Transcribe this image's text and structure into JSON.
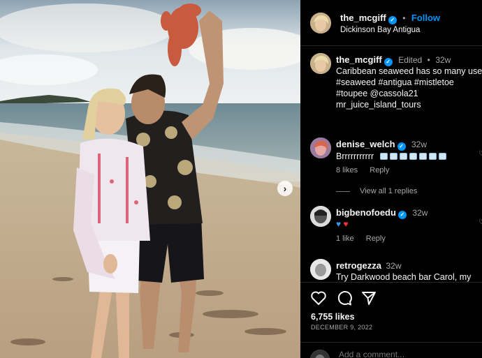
{
  "post": {
    "header": {
      "username": "the_mcgiff",
      "follow_label": "Follow",
      "location": "Dickinson Bay Antigua",
      "separator": "•"
    },
    "caption": {
      "username": "the_mcgiff",
      "edited": "Edited",
      "separator": "•",
      "time": "32w",
      "lines": [
        "Caribbean seaweed has so many uses",
        "#seaweed #antigua #mistletoe",
        "#toupee @cassola21",
        "mr_juice_island_tours"
      ]
    },
    "comments": [
      {
        "username": "denise_welch",
        "time": "32w",
        "text": "Brrrrrrrrrrr",
        "emoji": [
          "cube-emoji",
          "cube-emoji",
          "cube-emoji",
          "cube-emoji",
          "cube-emoji",
          "cube-emoji",
          "cube-emoji"
        ],
        "likes": "8 likes",
        "reply_label": "Reply",
        "view_replies": "View all 1 replies"
      },
      {
        "username": "bigbenofoedu",
        "time": "32w",
        "emoji": [
          "blue-heart-emoji",
          "red-heart-emoji"
        ],
        "likes": "1 like",
        "reply_label": "Reply"
      },
      {
        "username": "retrogezza",
        "time": "32w",
        "text": "Try Darkwood beach bar Carol, my"
      }
    ],
    "likes_count": "6,755 likes",
    "date": "DECEMBER 9, 2022",
    "add_comment_placeholder": "Add a comment..."
  },
  "colors": {
    "accent": "#0095f6",
    "background": "#000000",
    "muted_text": "#a8a8a8",
    "divider": "#262626",
    "red_heart": "#ff3040",
    "blue_heart": "#3797f0"
  },
  "icons": [
    "verified-badge-icon",
    "like-icon",
    "comment-icon",
    "share-icon",
    "next-photo-icon",
    "comment-like-icon"
  ]
}
